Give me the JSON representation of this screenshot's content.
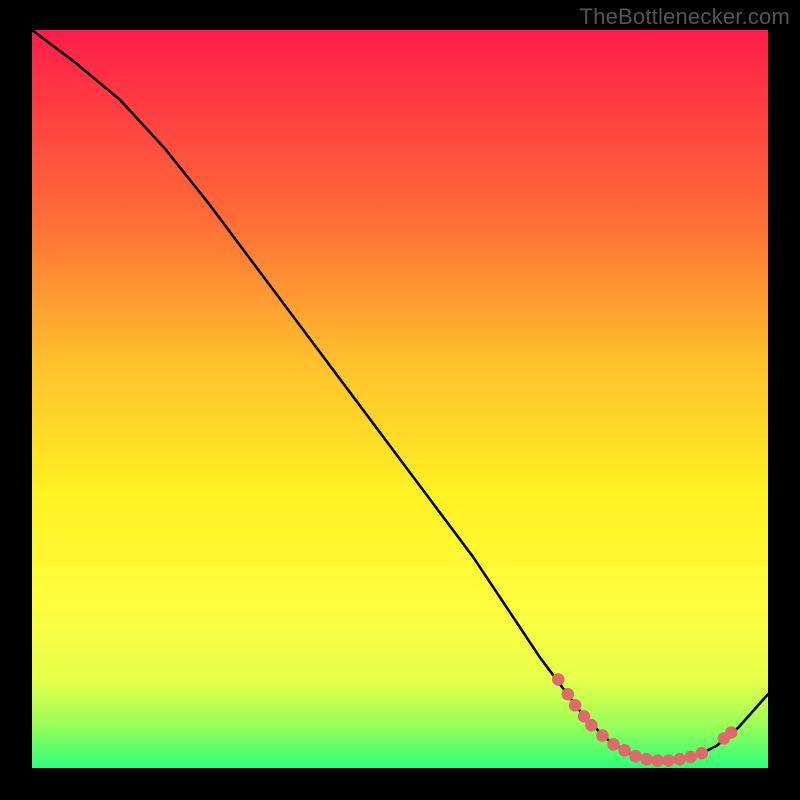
{
  "watermark": "TheBottlenecker.com",
  "chart_data": {
    "type": "line",
    "title": "",
    "xlabel": "",
    "ylabel": "",
    "xlim": [
      0,
      100
    ],
    "ylim": [
      0,
      100
    ],
    "background_gradient": [
      "#ff1d49",
      "#ff6a38",
      "#ffc02c",
      "#fff223",
      "#fffd3e",
      "#e6ff4a",
      "#9cff56",
      "#2cff7a"
    ],
    "series": [
      {
        "name": "bottleneck-curve",
        "color": "#000000",
        "x": [
          0,
          6,
          12,
          18,
          24,
          30,
          36,
          42,
          48,
          54,
          60,
          65,
          69,
          72,
          75,
          78,
          81,
          84,
          87,
          90,
          93,
          96,
          100
        ],
        "y": [
          100,
          95.5,
          90.5,
          84,
          76.5,
          68.5,
          60.5,
          52.5,
          44.5,
          36.5,
          28.5,
          21,
          15,
          11,
          7,
          4,
          2,
          1,
          1,
          1.5,
          3,
          5.5,
          10
        ]
      }
    ],
    "marker_points": {
      "name": "marker-points",
      "color": "#de6b6b",
      "points": [
        {
          "x": 71.5,
          "y": 12.0
        },
        {
          "x": 72.8,
          "y": 10.0
        },
        {
          "x": 73.8,
          "y": 8.5
        },
        {
          "x": 75.0,
          "y": 7.0
        },
        {
          "x": 76.0,
          "y": 5.8
        },
        {
          "x": 77.5,
          "y": 4.4
        },
        {
          "x": 79.0,
          "y": 3.2
        },
        {
          "x": 80.5,
          "y": 2.4
        },
        {
          "x": 82.0,
          "y": 1.6
        },
        {
          "x": 83.5,
          "y": 1.2
        },
        {
          "x": 85.0,
          "y": 1.0
        },
        {
          "x": 86.5,
          "y": 1.0
        },
        {
          "x": 88.0,
          "y": 1.2
        },
        {
          "x": 89.5,
          "y": 1.5
        },
        {
          "x": 91.0,
          "y": 2.0
        },
        {
          "x": 94.0,
          "y": 4.0
        },
        {
          "x": 95.0,
          "y": 4.8
        }
      ]
    }
  }
}
